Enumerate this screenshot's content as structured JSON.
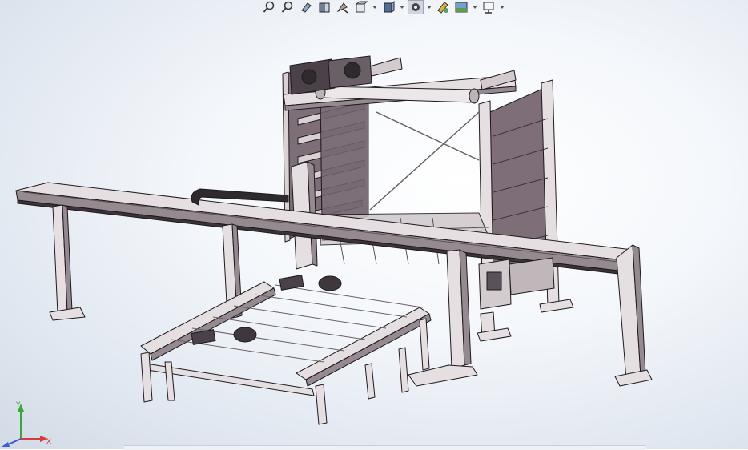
{
  "hud_toolbar": {
    "tools": [
      {
        "icon": "zoom-to-fit-icon"
      },
      {
        "icon": "zoom-to-area-icon"
      },
      {
        "icon": "previous-view-icon"
      },
      {
        "icon": "section-view-icon"
      },
      {
        "icon": "dynamic-annotation-icon"
      },
      {
        "icon": "view-orientation-icon",
        "dropdown": true
      },
      {
        "icon": "display-style-icon",
        "dropdown": true
      },
      {
        "icon": "hide-show-items-icon",
        "dropdown": true,
        "active": true
      },
      {
        "icon": "edit-appearance-icon"
      },
      {
        "icon": "apply-scene-icon",
        "dropdown": true
      },
      {
        "icon": "view-settings-icon",
        "dropdown": true
      }
    ]
  },
  "triad": {
    "x_label": "X",
    "y_label": "Y"
  },
  "colors": {
    "frame": "#e6dfe1",
    "frame_shadow": "#958a90",
    "panel": "#7d6e78",
    "edge": "#1e1a1e"
  }
}
